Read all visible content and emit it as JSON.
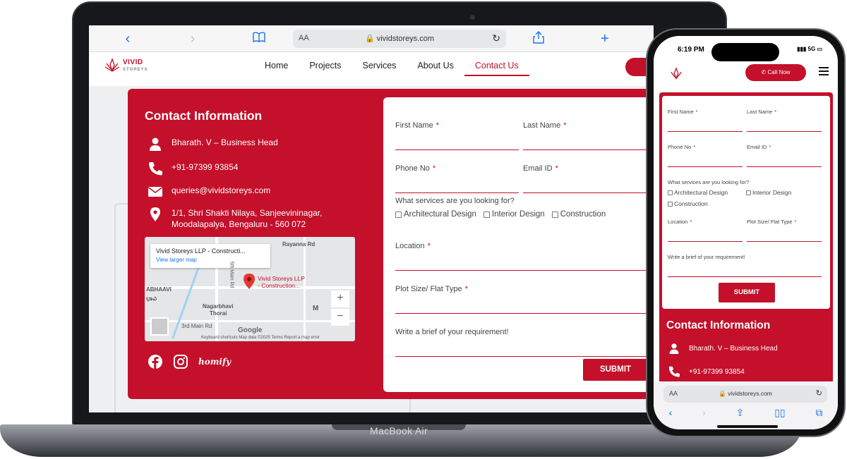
{
  "laptop": {
    "brand_label": "MacBook Air",
    "browser": {
      "aa": "AA",
      "url": "vividstoreys.com"
    },
    "site": {
      "logo": {
        "name": "VIVID",
        "tag": "STOREYS"
      },
      "nav": [
        "Home",
        "Projects",
        "Services",
        "About Us",
        "Contact Us"
      ],
      "active_nav": "Contact Us"
    },
    "contact_info": {
      "title": "Contact Information",
      "person": "Bharath. V – Business Head",
      "phone": "+91-97399 93854",
      "email": "queries@vividstoreys.com",
      "address_line1": "1/1, Shri Shakti Nilaya, Sanjeevininagar,",
      "address_line2": "Moodalapalya, Bengaluru - 560 072"
    },
    "map": {
      "card_title": "Vivid Storeys LLP - Constructi...",
      "card_link": "View larger map",
      "place_line1": "Vivid Storeys LLP",
      "place_line2": "- Construction...",
      "label_road": "Rayanna Rd",
      "label_area": "ABHAAVI",
      "label_area2": "ಭಾವಿ",
      "label_main": "5th Main Rd",
      "label_nagar1": "Nagarbhavi",
      "label_nagar2": "Thorai",
      "label_3rd": "3rd Main Rd",
      "label_m": "M",
      "zoom_in": "+",
      "zoom_out": "−",
      "google": "Google",
      "footer": "Keyboard shortcuts    Map data ©2025    Terms    Report a map error"
    },
    "socials": {
      "homify": "homify"
    },
    "form": {
      "first_name": "First Name",
      "last_name": "Last Name",
      "phone_no": "Phone No",
      "email_id": "Email ID",
      "req": "*",
      "services_q": "What services are you looking for?",
      "services": [
        "Architectural Design",
        "Interior Design",
        "Construction"
      ],
      "location": "Location",
      "plot": "Plot Size/ Flat Type",
      "brief": "Write a brief of your requirement!",
      "submit": "SUBMIT"
    }
  },
  "phone": {
    "time": "6:19 PM",
    "status": "5G",
    "call_now": "Call Now",
    "form": {
      "first_name": "First Name",
      "last_name": "Last Name",
      "phone_no": "Phone No",
      "email_id": "Email ID",
      "req": "*",
      "services_q": "What services are you looking for?",
      "services": [
        "Architectural Design",
        "Interior Design",
        "Construction"
      ],
      "location": "Location",
      "plot": "Plot Size/ Flat Type",
      "brief": "Write a brief of your requirement!",
      "submit": "SUBMIT"
    },
    "contact_info": {
      "title": "Contact Information",
      "person": "Bharath. V – Business Head",
      "phone": "+91-97399 93854"
    },
    "browser": {
      "aa": "AA",
      "url": "vividstoreys.com"
    }
  },
  "colors": {
    "brand_red": "#c4102a",
    "link_blue": "#1a73e8"
  }
}
